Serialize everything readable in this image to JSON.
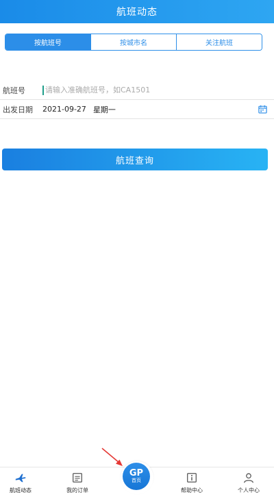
{
  "header": {
    "title": "航班动态"
  },
  "tabs": [
    {
      "label": "按航班号",
      "active": true
    },
    {
      "label": "按城市名",
      "active": false
    },
    {
      "label": "关注航班",
      "active": false
    }
  ],
  "form": {
    "flight_no": {
      "label": "航班号",
      "value": "",
      "placeholder": "请输入准确航班号，如CA1501"
    },
    "departure_date": {
      "label": "出发日期",
      "date": "2021-09-27",
      "weekday": "星期一"
    }
  },
  "query_button": {
    "label": "航班查询"
  },
  "tabbar": {
    "items": [
      {
        "label": "航班动态",
        "icon": "plane-icon",
        "active": true
      },
      {
        "label": "我的订单",
        "icon": "order-icon",
        "active": false
      },
      {
        "label": "首页",
        "icon": "home-logo-icon",
        "logo_text": "GP",
        "active": false
      },
      {
        "label": "帮助中心",
        "icon": "info-icon",
        "active": false
      },
      {
        "label": "个人中心",
        "icon": "user-icon",
        "active": false
      }
    ]
  },
  "colors": {
    "accent": "#2c8ee8",
    "header": "#1a8be8",
    "annotation_arrow": "#e53935"
  }
}
